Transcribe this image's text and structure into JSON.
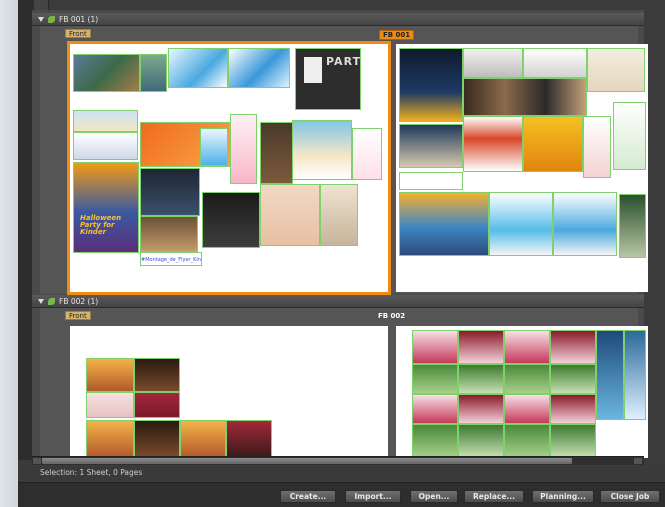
{
  "groups": [
    {
      "header": "FB 001 (1)",
      "front_label": "Front",
      "sheet_title": "FB 001"
    },
    {
      "header": "FB 002 (1)",
      "front_label": "Front",
      "sheet_title": "FB 002"
    }
  ],
  "tiles": {
    "party": "PARTY",
    "halloween": "Halloween Party for Kinder",
    "filename": "#Montage_de_Flyer_Kinder"
  },
  "status": {
    "selection": "Selection:  1 Sheet,  0 Pages"
  },
  "buttons": {
    "create": "Create...",
    "import": "Import...",
    "open": "Open...",
    "replace": "Replace...",
    "planning": "Planning...",
    "close": "Close Job"
  },
  "colors": {
    "selected": "#f08c12",
    "tile_border": "#7fd26b",
    "label_blue": "#3b4bdc"
  }
}
